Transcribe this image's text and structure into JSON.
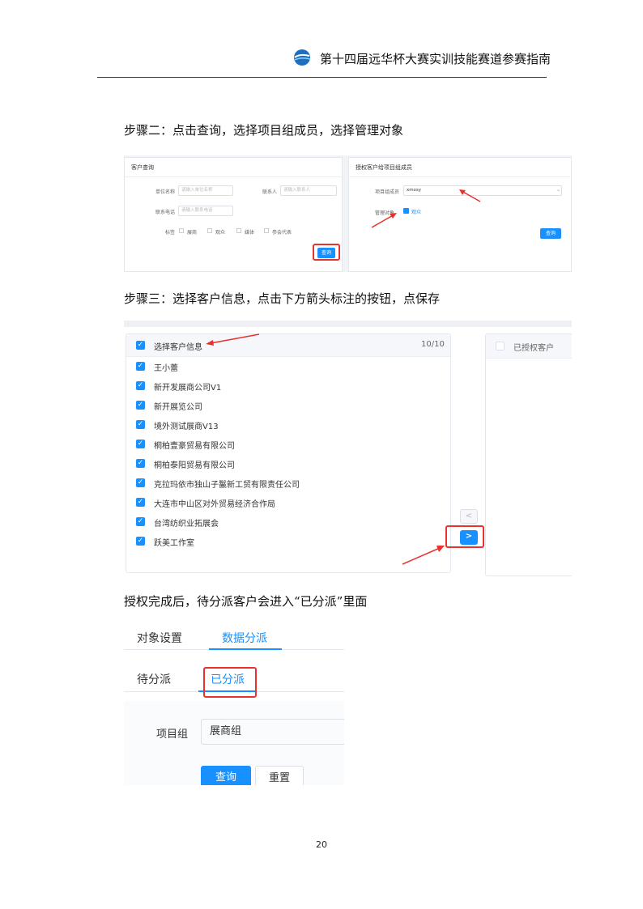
{
  "header": {
    "title": "第十四届远华杯大赛实训技能赛道参赛指南"
  },
  "steps": {
    "step2": "步骤二：点击查询，选择项目组成员，选择管理对象",
    "step3": "步骤三：选择客户信息，点击下方箭头标注的按钮，点保存",
    "after": "授权完成后，待分派客户会进入“已分派”里面"
  },
  "shot1": {
    "left_panel": {
      "title": "客户查询",
      "fields": [
        {
          "label": "单位名称",
          "placeholder": "请输入单位名称"
        },
        {
          "label": "联系人",
          "placeholder": "请输入联系人"
        },
        {
          "label": "联系电话",
          "placeholder": "请输入联系电话"
        }
      ],
      "tag_label": "标签",
      "tags": [
        "展商",
        "观众",
        "媒体",
        "参会代表"
      ],
      "query_button": "查询"
    },
    "right_panel": {
      "title": "授权客户给项目组成员",
      "member_label": "项目组成员",
      "member_value": "xmxsy",
      "manage_label": "管理对象",
      "manage_option": "观众",
      "query_button": "查询"
    }
  },
  "shot2": {
    "header_label": "选择客户信息",
    "count": "10/10",
    "items": [
      "王小蕾",
      "新开发展商公司V1",
      "新开展览公司",
      "境外测试展商V13",
      "桐柏壹豪贸易有限公司",
      "桐柏泰阳贸易有限公司",
      "克拉玛依市独山子鬣新工贸有限责任公司",
      "大连市中山区对外贸易经济合作局",
      "台湾纺织业拓展会",
      "跃美工作室"
    ],
    "left_arrow": "<",
    "right_arrow": ">",
    "right_header": "已授权客户"
  },
  "shot3": {
    "tabs_top": [
      "对象设置",
      "数据分派"
    ],
    "tabs_sub": [
      "待分派",
      "已分派"
    ],
    "field_label": "项目组",
    "field_value": "展商组",
    "query_button": "查询",
    "reset_button": "重置"
  },
  "page_number": "20"
}
